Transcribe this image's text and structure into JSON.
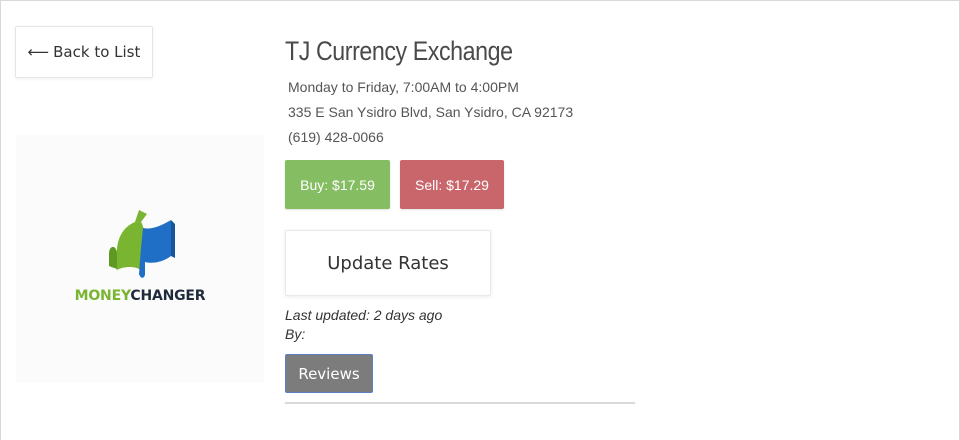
{
  "nav": {
    "back_arrow": "⟵",
    "back_label": "Back to List"
  },
  "logo": {
    "word1": "MONEY",
    "word2": "CHANGER",
    "colors": {
      "green": "#7ab532",
      "blue": "#1f6fc6",
      "dark": "#1f2a3a"
    }
  },
  "exchange": {
    "name": "TJ Currency Exchange",
    "hours": "Monday to Friday, 7:00AM to 4:00PM",
    "address": "335 E San Ysidro Blvd, San Ysidro, CA 92173",
    "phone": "(619) 428-0066"
  },
  "rates": {
    "buy_label": "Buy: $17.59",
    "sell_label": "Sell: $17.29",
    "buy_color": "#85bd63",
    "sell_color": "#c8666c"
  },
  "actions": {
    "update_label": "Update Rates",
    "reviews_label": "Reviews"
  },
  "meta": {
    "last_updated": "Last updated: 2 days ago",
    "by": "By:"
  }
}
